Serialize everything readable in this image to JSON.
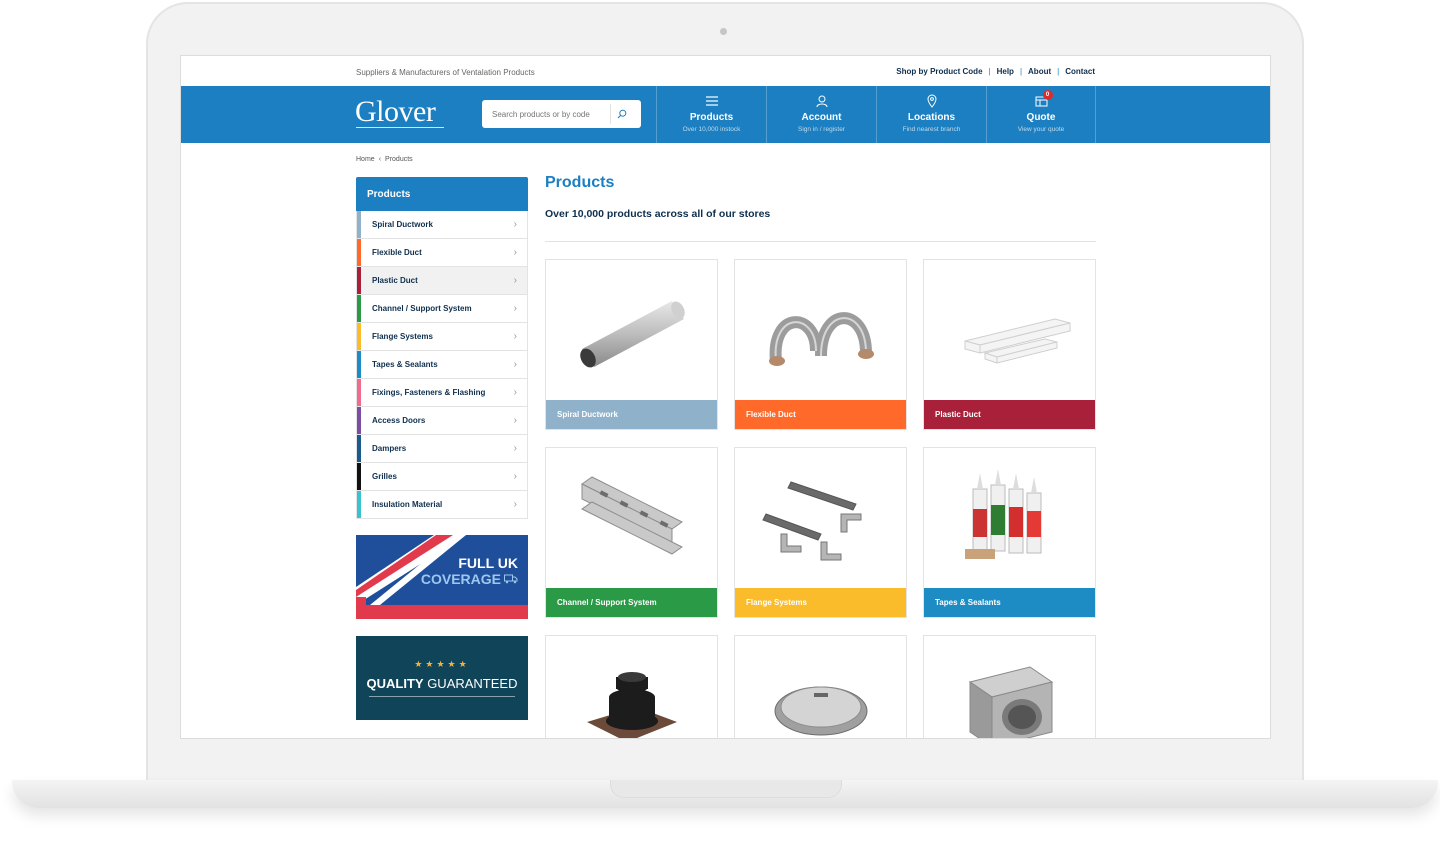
{
  "topbar": {
    "tagline": "Suppliers & Manufacturers of Ventalation Products",
    "links": [
      "Shop by Product Code",
      "Help",
      "About",
      "Contact"
    ]
  },
  "header": {
    "logo": "Glover",
    "search_placeholder": "Search products or by code",
    "nav": [
      {
        "label": "Products",
        "sub": "Over 10,000 instock",
        "icon": "menu-icon"
      },
      {
        "label": "Account",
        "sub": "Sign in / register",
        "icon": "user-icon"
      },
      {
        "label": "Locations",
        "sub": "Find nearest branch",
        "icon": "map-pin-icon"
      },
      {
        "label": "Quote",
        "sub": "View your quote",
        "icon": "quote-icon",
        "badge": "0"
      }
    ]
  },
  "breadcrumb": [
    "Home",
    "Products"
  ],
  "sidebar": {
    "title": "Products",
    "items": [
      {
        "label": "Spiral Ductwork",
        "color": "#8fb1c9"
      },
      {
        "label": "Flexible Duct",
        "color": "#ff6a2b"
      },
      {
        "label": "Plastic Duct",
        "color": "#a8203a"
      },
      {
        "label": "Channel / Support System",
        "color": "#2a9a47"
      },
      {
        "label": "Flange Systems",
        "color": "#fbbc2c"
      },
      {
        "label": "Tapes & Sealants",
        "color": "#1e8cc4"
      },
      {
        "label": "Fixings, Fasteners & Flashing",
        "color": "#f06b8d"
      },
      {
        "label": "Access Doors",
        "color": "#7b4ea2"
      },
      {
        "label": "Dampers",
        "color": "#1b5a8e"
      },
      {
        "label": "Grilles",
        "color": "#111111"
      },
      {
        "label": "Insulation Material",
        "color": "#3bc2d1"
      }
    ]
  },
  "promos": {
    "uk_line1": "FULL UK",
    "uk_line2": "COVERAGE",
    "stars": "★★★★★",
    "quality_bold": "QUALITY",
    "quality_rest": " GUARANTEED"
  },
  "main": {
    "title": "Products",
    "subtitle": "Over 10,000 products across all of our stores",
    "cards": [
      {
        "label": "Spiral Ductwork",
        "color": "#8fb1c9",
        "icon": "spiral-duct-image"
      },
      {
        "label": "Flexible Duct",
        "color": "#ff6a2b",
        "icon": "flexible-duct-image"
      },
      {
        "label": "Plastic Duct",
        "color": "#a8203a",
        "icon": "plastic-duct-image"
      },
      {
        "label": "Channel / Support System",
        "color": "#2a9a47",
        "icon": "channel-image"
      },
      {
        "label": "Flange Systems",
        "color": "#fbbc2c",
        "icon": "flange-image"
      },
      {
        "label": "Tapes & Sealants",
        "color": "#1e8cc4",
        "icon": "sealant-image"
      },
      {
        "label": "",
        "color": "#f06b8d",
        "icon": "flashing-image"
      },
      {
        "label": "",
        "color": "#7b4ea2",
        "icon": "access-door-image"
      },
      {
        "label": "",
        "color": "#1b5a8e",
        "icon": "damper-image"
      }
    ]
  }
}
